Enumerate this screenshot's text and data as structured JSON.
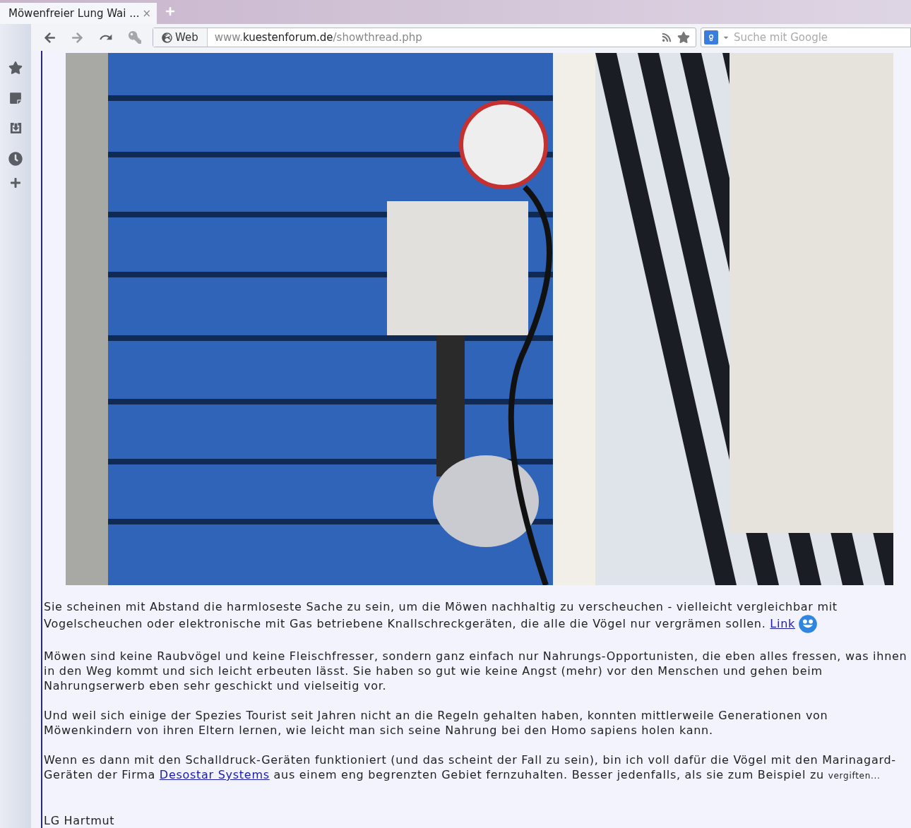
{
  "tab": {
    "title": "Möwenfreier Lung Wai ...",
    "close": "×"
  },
  "toolbar": {
    "address_label": "Web",
    "url_prefix": "www.",
    "url_domain": "kuestenforum.de",
    "url_path": "/showthread.php",
    "search_placeholder": "Suche mit Google"
  },
  "post": {
    "photo": {
      "kind": "picture"
    },
    "paragraphs": [
      [
        {
          "kind": "text",
          "text": "Sie scheinen mit Abstand die harmloseste Sache zu sein, um die Möwen nachhaltig zu verscheuchen - vielleicht vergleichbar mit Vogelscheuchen oder elektronische mit Gas betriebene Knallschreckgeräten, die alle die Vögel nur vergrämen sollen. "
        },
        {
          "kind": "link",
          "text": "Link"
        },
        {
          "kind": "smiley"
        }
      ],
      [
        {
          "kind": "text",
          "text": "Möwen sind keine Raubvögel und keine Fleischfresser, sondern ganz einfach nur Nahrungs-Opportunisten, die eben alles fressen, was ihnen in den Weg kommt und sich leicht erbeuten lässt. Sie haben so gut wie keine Angst (mehr) vor den Menschen und gehen beim Nahrungserwerb eben sehr geschickt und vielseitig vor."
        }
      ],
      [
        {
          "kind": "text",
          "text": "Und weil sich einige der Spezies Tourist seit Jahren nicht an die Regeln gehalten haben, konnten mittlerweile Generationen von Möwenkindern von ihren Eltern lernen, wie leicht man sich seine Nahrung bei den Homo sapiens holen kann."
        }
      ],
      [
        {
          "kind": "text",
          "text": "Wenn es dann mit den Schalldruck-Geräten funktioniert (und das scheint der Fall zu sein), bin ich voll dafür die Vögel mit den Marinagard-Geräten der Firma "
        },
        {
          "kind": "link",
          "text": "Desostar Systems"
        },
        {
          "kind": "text",
          "text": " aus einem eng begrenzten Gebiet fernzuhalten. Besser jedenfalls, als sie zum Beispiel zu "
        },
        {
          "kind": "small",
          "text": "vergiften..."
        }
      ]
    ],
    "signature": "LG Hartmut"
  }
}
